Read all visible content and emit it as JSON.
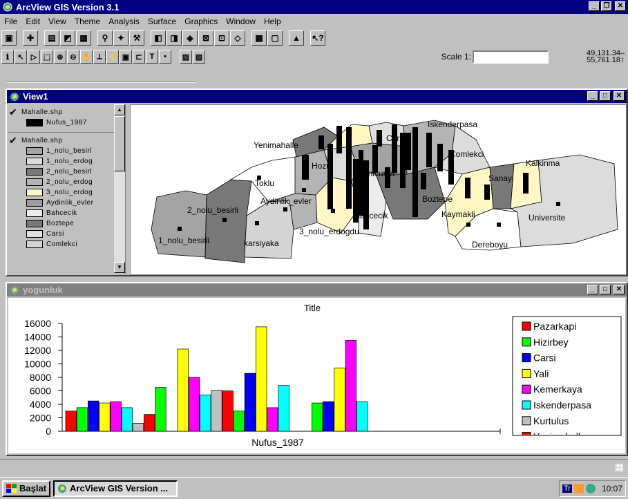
{
  "app": {
    "title": "ArcView GIS Version 3.1"
  },
  "menu": [
    "File",
    "Edit",
    "View",
    "Theme",
    "Analysis",
    "Surface",
    "Graphics",
    "Window",
    "Help"
  ],
  "scale": {
    "label": "Scale 1:",
    "value": ""
  },
  "coords": {
    "x": "49,131.34",
    "y": "55,761.18"
  },
  "view": {
    "title": "View1",
    "toc": {
      "theme1": {
        "name": "Mahalle.shp",
        "field": "Nufus_1987"
      },
      "theme2": {
        "name": "Mahalle.shp",
        "items": [
          {
            "label": "1_nolu_besirl",
            "color": "#a4a4a4"
          },
          {
            "label": "1_nolu_erdog",
            "color": "#dcdcdc"
          },
          {
            "label": "2_nolu_besirl",
            "color": "#787878"
          },
          {
            "label": "2_nolu_erdog",
            "color": "#b4b4b4"
          },
          {
            "label": "3_nolu_erdog",
            "color": "#fff8c4"
          },
          {
            "label": "Aydinlik_evler",
            "color": "#9c9c9c"
          },
          {
            "label": "Bahcecik",
            "color": "#ececec"
          },
          {
            "label": "Boztepe",
            "color": "#787878"
          },
          {
            "label": "Carsi",
            "color": "#e0e0e0"
          },
          {
            "label": "Comlekci",
            "color": "#d4d4d4"
          }
        ]
      }
    },
    "map_labels": {
      "iskenderpasa": "Iskenderpasa",
      "yenimahalle": "Yenimahalle",
      "carsi": "Carsi",
      "comlekci": "Comlekci",
      "kalkinma": "Kalkinma",
      "hozu": "Hozu",
      "yenicuma": "Yenicuma",
      "sanayi": "Sanayi",
      "toklu": "Toklu",
      "boztepe": "Boztepe",
      "aydinlik": "Aydinlik_evler",
      "besirli2": "2_nolu_besirli",
      "kaymakli": "Kaymakli",
      "bahcecik": "Bahcecik",
      "universite": "Universite",
      "erdogdu3": "3_nolu_erdogdu",
      "besirli1": "1_nolu_besirli",
      "karsiyaka": "karsiyaka",
      "dereboyu": "Dereboyu"
    }
  },
  "chart_window": {
    "title": "yogunluk"
  },
  "chart_data": {
    "type": "bar",
    "title": "Title",
    "xlabel": "Nufus_1987",
    "ylim": [
      0,
      16000
    ],
    "yticks": [
      "16000",
      "14000",
      "12000",
      "10000",
      "8000",
      "6000",
      "4000",
      "2000",
      "0"
    ],
    "legend": [
      {
        "name": "Pazarkapi",
        "color": "#ff0000"
      },
      {
        "name": "Hizirbey",
        "color": "#00ff00"
      },
      {
        "name": "Carsi",
        "color": "#0000ff"
      },
      {
        "name": "Yali",
        "color": "#ffff00"
      },
      {
        "name": "Kemerkaya",
        "color": "#ff00ff"
      },
      {
        "name": "Iskenderpasa",
        "color": "#00ffff"
      },
      {
        "name": "Kurtulus",
        "color": "#c0c0c0"
      },
      {
        "name": "Yenimahalle",
        "color": "#ff0000"
      }
    ],
    "bars": [
      {
        "value": 3000,
        "color": "#ff0000"
      },
      {
        "value": 3500,
        "color": "#00ff00"
      },
      {
        "value": 4500,
        "color": "#0000ff"
      },
      {
        "value": 4200,
        "color": "#ffff00"
      },
      {
        "value": 4400,
        "color": "#ff00ff"
      },
      {
        "value": 3500,
        "color": "#00ffff"
      },
      {
        "value": 1200,
        "color": "#c0c0c0"
      },
      {
        "value": 2500,
        "color": "#ff0000"
      },
      {
        "value": 6500,
        "color": "#00ff00"
      },
      {
        "value": null,
        "color": "#0000ff"
      },
      {
        "value": 12200,
        "color": "#ffff00"
      },
      {
        "value": 8000,
        "color": "#ff00ff"
      },
      {
        "value": 5400,
        "color": "#00ffff"
      },
      {
        "value": 6100,
        "color": "#c0c0c0"
      },
      {
        "value": 6000,
        "color": "#ff0000"
      },
      {
        "value": 3000,
        "color": "#00ff00"
      },
      {
        "value": 8600,
        "color": "#0000ff"
      },
      {
        "value": 15500,
        "color": "#ffff00"
      },
      {
        "value": 3500,
        "color": "#ff00ff"
      },
      {
        "value": 6800,
        "color": "#00ffff"
      },
      {
        "value": null,
        "color": "#c0c0c0"
      },
      {
        "value": null,
        "color": "#ff0000"
      },
      {
        "value": 4200,
        "color": "#00ff00"
      },
      {
        "value": 4400,
        "color": "#0000ff"
      },
      {
        "value": 9400,
        "color": "#ffff00"
      },
      {
        "value": 13500,
        "color": "#ff00ff"
      },
      {
        "value": 4400,
        "color": "#00ffff"
      }
    ]
  },
  "taskbar": {
    "start": "Başlat",
    "task": "ArcView GIS Version ...",
    "clock": "10:07",
    "lang": "Tr"
  }
}
